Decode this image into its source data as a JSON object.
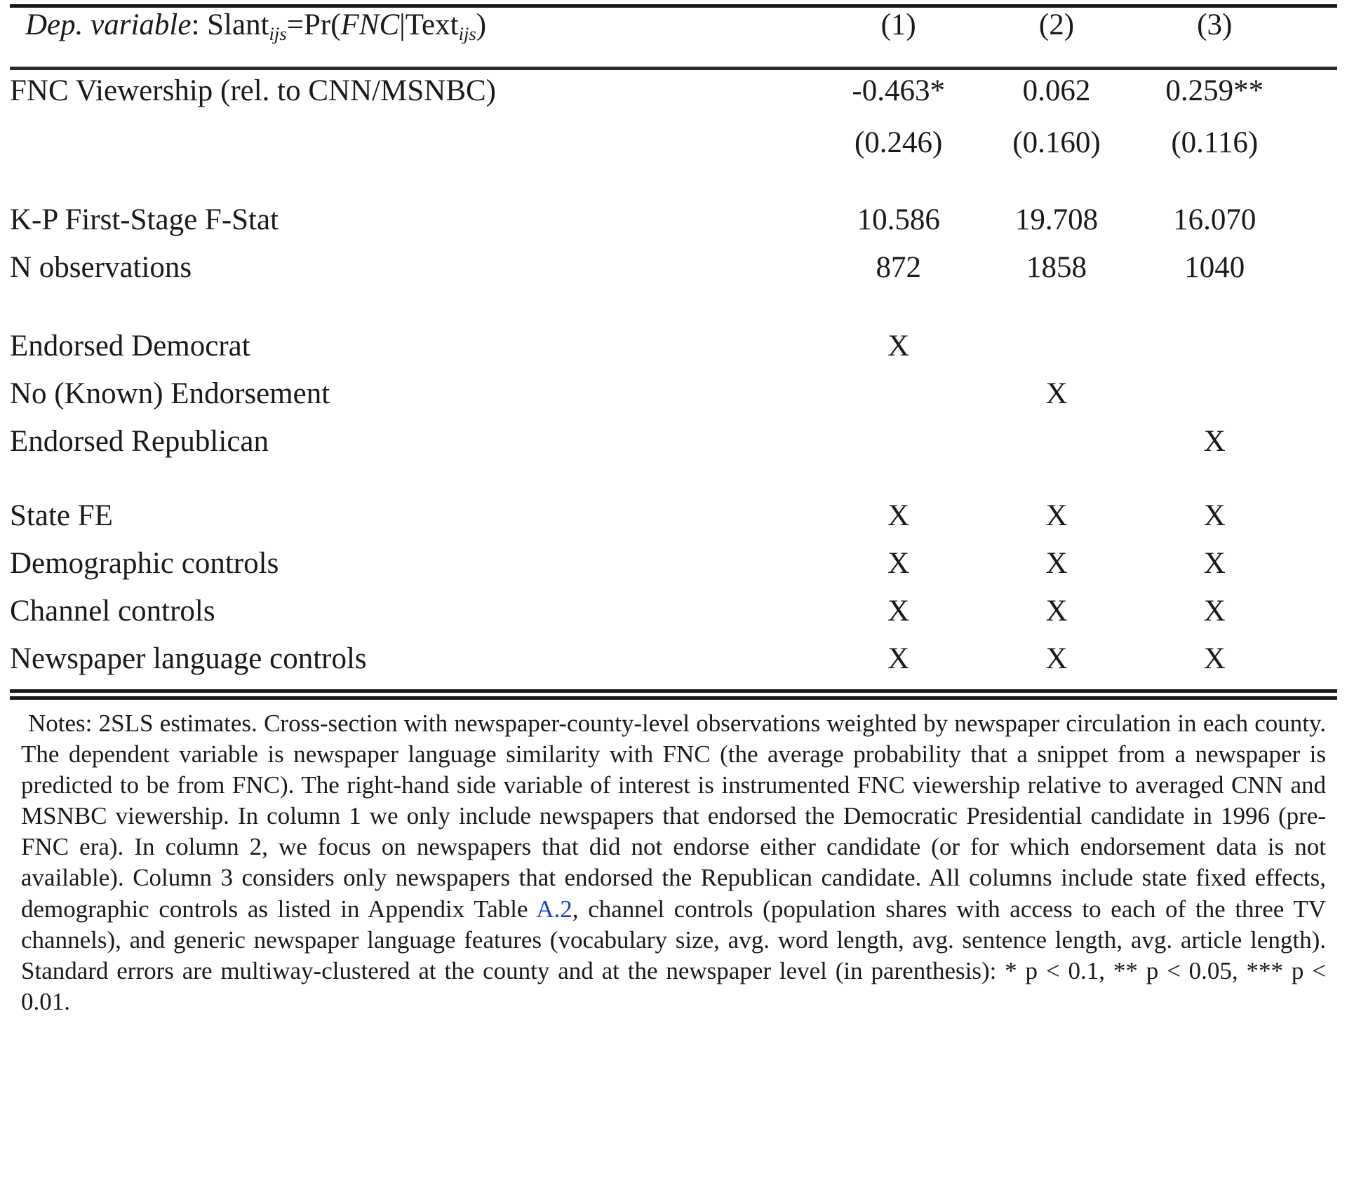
{
  "table": {
    "header": {
      "dep_variable_prefix": "Dep. variable",
      "dep_variable_text": ": Slant",
      "dep_sub1": "ijs",
      "dep_eq": "=Pr(",
      "dep_math": "FNC",
      "dep_bar": "|",
      "dep_text2": "Text",
      "dep_sub2": "ijs",
      "dep_close": ")",
      "col1": "(1)",
      "col2": "(2)",
      "col3": "(3)"
    },
    "coefficient_rows": [
      {
        "label": "FNC Viewership (rel. to CNN/MSNBC)",
        "values": [
          "-0.463",
          "0.062",
          "0.259"
        ],
        "stars": [
          "*",
          "",
          "**"
        ],
        "std_errors": [
          "(0.246)",
          "(0.160)",
          "(0.116)"
        ]
      }
    ],
    "stat_rows": [
      {
        "label": "K-P First-Stage F-Stat",
        "values": [
          "10.586",
          "19.708",
          "16.070"
        ]
      },
      {
        "label": "N observations",
        "values": [
          "872",
          "1858",
          "1040"
        ]
      }
    ],
    "sample_rows": [
      {
        "label": "Endorsed Democrat",
        "values": [
          "X",
          "",
          ""
        ]
      },
      {
        "label": "No (Known) Endorsement",
        "values": [
          "",
          "X",
          ""
        ]
      },
      {
        "label": "Endorsed Republican",
        "values": [
          "",
          "",
          "X"
        ]
      }
    ],
    "control_rows": [
      {
        "label": "State FE",
        "values": [
          "X",
          "X",
          "X"
        ]
      },
      {
        "label": "Demographic controls",
        "values": [
          "X",
          "X",
          "X"
        ]
      },
      {
        "label": "Channel controls",
        "values": [
          "X",
          "X",
          "X"
        ]
      },
      {
        "label": "Newspaper language controls",
        "values": [
          "X",
          "X",
          "X"
        ]
      }
    ]
  },
  "notes": {
    "part1": "Notes: 2SLS estimates. Cross-section with newspaper-county-level observations weighted by newspaper circulation in each county. The dependent variable is newspaper language similarity with FNC (the average probability that a snippet from a newspaper is predicted to be from FNC). The right-hand side variable of interest is instrumented FNC viewership relative to averaged CNN and MSNBC viewership. In column 1 we only include newspapers that endorsed the Democratic Presidential candidate in 1996 (pre-FNC era). In column 2, we focus on newspapers that did not endorse either candidate (or for which endorsement data is not available). Column 3 considers only newspapers that endorsed the Republican candidate. All columns include state fixed effects, demographic controls as listed in Appendix Table ",
    "link": "A.2",
    "part2": ", channel controls (population shares with access to each of the three TV channels), and generic newspaper language features (vocabulary size, avg. word length, avg. sentence length, avg. article length). Standard errors are multiway-clustered at the county and at the newspaper level (in parenthesis): * p < 0.1, ** p < 0.05, *** p < 0.01."
  }
}
